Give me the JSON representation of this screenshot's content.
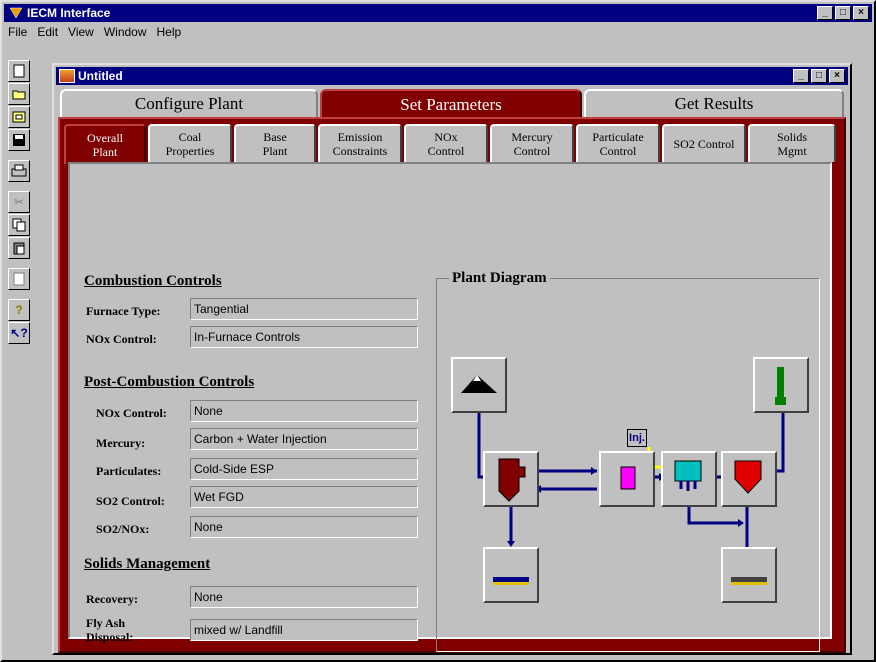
{
  "app": {
    "title": "IECM Interface",
    "menu": [
      "File",
      "Edit",
      "View",
      "Window",
      "Help"
    ],
    "window_buttons": [
      "minimize",
      "maximize",
      "close"
    ]
  },
  "toolbar": {
    "items": [
      "new-document-icon",
      "open-folder-icon",
      "save-to-disk-icon",
      "floppy-disk-icon",
      "print-icon",
      "cut-icon",
      "copy-icon",
      "paste-icon",
      "properties-icon",
      "help-icon",
      "context-help-icon"
    ]
  },
  "child": {
    "title": "Untitled"
  },
  "main_tabs": [
    {
      "label": "Configure Plant",
      "active": false
    },
    {
      "label": "Set Parameters",
      "active": true
    },
    {
      "label": "Get Results",
      "active": false
    }
  ],
  "sub_tabs": [
    {
      "line1": "Overall",
      "line2": "Plant",
      "active": true
    },
    {
      "line1": "Coal",
      "line2": "Properties",
      "active": false
    },
    {
      "line1": "Base",
      "line2": "Plant",
      "active": false
    },
    {
      "line1": "Emission",
      "line2": "Constraints",
      "active": false
    },
    {
      "line1": "NOx",
      "line2": "Control",
      "active": false
    },
    {
      "line1": "Mercury",
      "line2": "Control",
      "active": false
    },
    {
      "line1": "Particulate",
      "line2": "Control",
      "active": false
    },
    {
      "line1": "SO2 Control",
      "line2": "",
      "active": false
    },
    {
      "line1": "Solids",
      "line2": "Mgmt",
      "active": false
    }
  ],
  "combustion": {
    "heading": "Combustion Controls",
    "furnace_type_label": "Furnace Type:",
    "furnace_type": "Tangential",
    "nox_label": "NOx Control:",
    "nox": "In-Furnace Controls"
  },
  "post_combustion": {
    "heading": "Post-Combustion Controls",
    "nox_label": "NOx Control:",
    "nox": "None",
    "mercury_label": "Mercury:",
    "mercury": "Carbon + Water Injection",
    "particulates_label": "Particulates:",
    "particulates": "Cold-Side ESP",
    "so2_label": "SO2 Control:",
    "so2": "Wet FGD",
    "so2nox_label": "SO2/NOx:",
    "so2nox": "None"
  },
  "solids": {
    "heading": "Solids Management",
    "recovery_label": "Recovery:",
    "recovery": "None",
    "flyash_label_1": "Fly Ash",
    "flyash_label_2": "Disposal:",
    "flyash": "mixed w/ Landfill"
  },
  "diagram": {
    "title": "Plant Diagram",
    "inj_label": "Inj.",
    "colors": {
      "flow": "#000080",
      "boiler": "#800000",
      "fgd": "#e00000",
      "stack": "#008000",
      "injection": "#ffff00",
      "esp": "#00c0c0",
      "scr": "#ff00ff"
    }
  }
}
